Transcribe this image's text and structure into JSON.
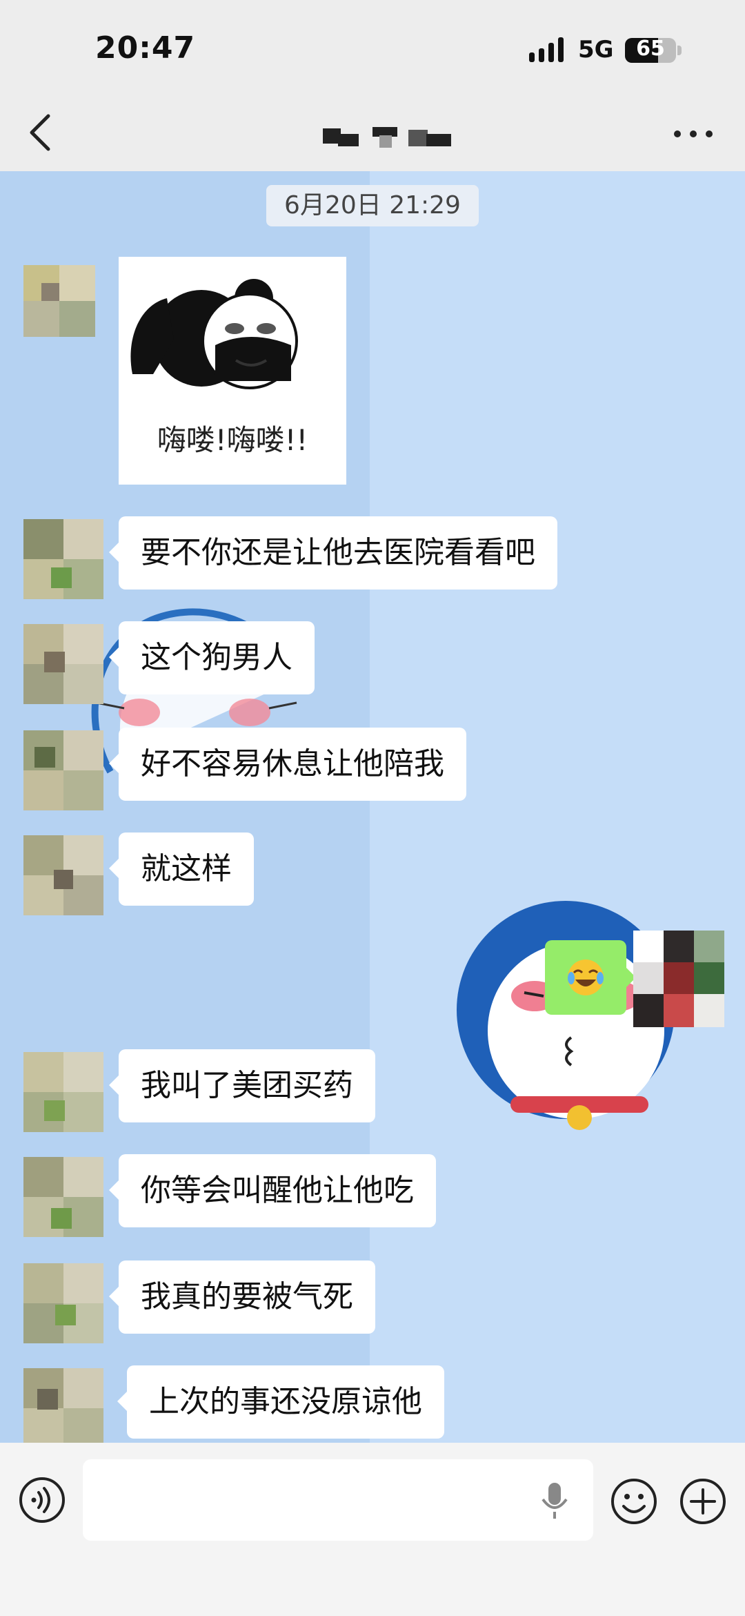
{
  "status_bar": {
    "time": "20:47",
    "network": "5G",
    "battery_level": "65",
    "battery_percent": 65
  },
  "nav": {
    "title": ""
  },
  "chat": {
    "timestamp": "6月20日 21:29",
    "sticker": {
      "caption": "嗨喽!嗨喽!!"
    },
    "messages": [
      {
        "text": "要不你还是让他去医院看看吧"
      },
      {
        "text": "这个狗男人"
      },
      {
        "text": "好不容易休息让他陪我"
      },
      {
        "text": "就这样"
      },
      {
        "text": "我叫了美团买药"
      },
      {
        "text": "你等会叫醒他让他吃"
      },
      {
        "text": "我真的要被气死"
      },
      {
        "text": "上次的事还没原谅他"
      }
    ]
  },
  "icons": {
    "back": "chevron-left-icon",
    "more": "ellipsis-icon",
    "voice": "voice-icon",
    "mic": "mic-icon",
    "emoji": "smile-icon",
    "plus": "plus-icon"
  },
  "colors": {
    "self_bubble": "#95ec69",
    "other_bubble": "#ffffff",
    "chat_bg": "#c5ddf8"
  }
}
